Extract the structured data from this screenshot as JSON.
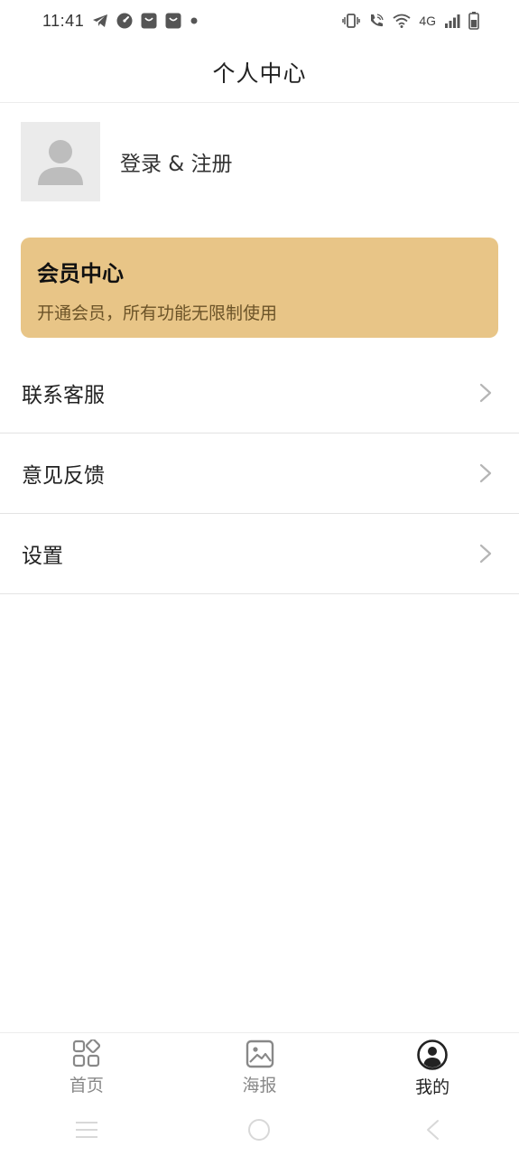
{
  "status_bar": {
    "time": "11:41",
    "network": "4G",
    "icons": [
      "telegram-icon",
      "speedometer-icon",
      "shopping-bag-icon",
      "shopping-bag-icon",
      "dot-icon",
      "vibrate-icon",
      "wifi-call-icon",
      "wifi-icon",
      "signal-icon",
      "battery-icon"
    ]
  },
  "header": {
    "title": "个人中心"
  },
  "profile": {
    "login_label": "登录 & 注册",
    "avatar_icon": "user-silhouette-icon"
  },
  "member_card": {
    "title": "会员中心",
    "subtitle": "开通会员，所有功能无限制使用",
    "color": "#e8c587"
  },
  "menu": {
    "items": [
      {
        "label": "联系客服"
      },
      {
        "label": "意见反馈"
      },
      {
        "label": "设置"
      }
    ]
  },
  "tab_bar": {
    "tabs": [
      {
        "label": "首页",
        "icon": "grid-apps-icon",
        "active": false
      },
      {
        "label": "海报",
        "icon": "image-icon",
        "active": false
      },
      {
        "label": "我的",
        "icon": "user-circle-icon",
        "active": true
      }
    ]
  },
  "system_nav": {
    "icons": [
      "recent-apps-icon",
      "home-circle-icon",
      "back-icon"
    ]
  }
}
